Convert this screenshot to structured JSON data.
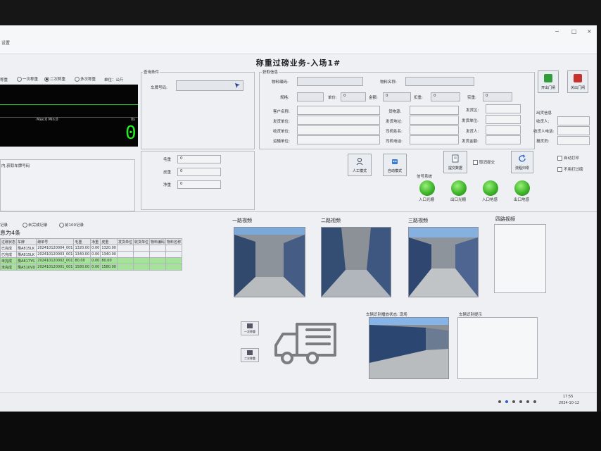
{
  "window": {
    "left_label": "设置",
    "controls": [
      "−",
      "□",
      "×"
    ]
  },
  "main_title": "称重过磅业务-入场1#",
  "weighing_mode": {
    "cut_label": "称重",
    "options": [
      "一次称重",
      "二次称重",
      "多次称重"
    ],
    "selected": 1,
    "unit_label": "单位：公斤"
  },
  "scale": {
    "max_label": "Max:0 Min:0",
    "corner": "0s",
    "reading": "0"
  },
  "plate_hint": "内,获取车牌号码",
  "query": {
    "title": "查询条件",
    "plate_label": "车牌号码:",
    "plate_value": ""
  },
  "info": {
    "title": "获取信息",
    "material_code_label": "物料编码:",
    "material_name_label": "物料名称:",
    "spec_label": "规格:",
    "unit_price_label": "单价:",
    "unit_price_value": "0",
    "amount_label": "金额:",
    "amount_value": "0",
    "deduct_label": "扣重:",
    "deduct_value": "0",
    "actual_label": "实重:",
    "actual_value": "0",
    "customer_label": "客户名称:",
    "shipper_unit_label": "发货单位:",
    "receiver_unit_label": "收货单位:",
    "transport_unit_label": "运输单位:",
    "origin_label": "货物源:",
    "ship_addr_label": "发货地址:",
    "driver_name_label": "司机姓名:",
    "driver_phone_label": "司机电话:",
    "shipping_area_label": "发货区:",
    "ship_unit2_label": "发货单位:",
    "shipper_person_label": "发货人:",
    "ship_amount_label": "发货金额:"
  },
  "gates": {
    "open_label": "开出门闸",
    "close_label": "关出门闸"
  },
  "out_info": {
    "title": "出货信息",
    "receiver_label": "收货人:",
    "receiver_phone_label": "收货人电话:",
    "report_label": "报货员:"
  },
  "weights": {
    "gross_label": "毛重",
    "gross_value": "0",
    "tare_label": "皮重",
    "tare_value": "0",
    "net_label": "净重",
    "net_value": "0"
  },
  "actions": {
    "manual": "人工模式",
    "auto": "自动模式",
    "submit": "提交数据",
    "cancel_submit": "取消提交",
    "reset": "流程归零",
    "auto_print": "自动打印",
    "no_print": "不用打过磅"
  },
  "signals": {
    "title": "信号系统",
    "items": [
      "入口光栅",
      "出口光栅",
      "入口地感",
      "出口地感"
    ],
    "color": "#3fb52a"
  },
  "records": {
    "options": [
      "记录",
      "未完成记录",
      "前100记录"
    ],
    "count_text": "息为4条",
    "headers": [
      "过磅状态",
      "车牌",
      "磅单号",
      "毛重",
      "净重",
      "皮重",
      "发货单位",
      "收货单位",
      "物料编码",
      "物料名称"
    ],
    "rows": [
      {
        "status": "已完成",
        "plate": "豫A815LK",
        "no": "202410120004_001",
        "gross": "1320.00",
        "net": "0.00",
        "tare": "1320.00",
        "green": false
      },
      {
        "status": "已完成",
        "plate": "豫A815LK",
        "no": "202410120003_001",
        "gross": "1340.00",
        "net": "0.00",
        "tare": "1340.00",
        "green": false
      },
      {
        "status": "未完成",
        "plate": "豫A817YS",
        "no": "202410120002_001",
        "gross": "80.00",
        "net": "0.00",
        "tare": "80.00",
        "green": true
      },
      {
        "status": "未完成",
        "plate": "豫A510VD",
        "no": "202410120001_001",
        "gross": "1580.00",
        "net": "0.00",
        "tare": "1580.00",
        "green": true
      }
    ]
  },
  "cameras": {
    "cam1": "一路视频",
    "cam2": "二路视频",
    "cam3": "三路视频",
    "cam4": "四路视频",
    "recog_label": "车辆识别播放状态: 现场",
    "recog2_label": "车辆识别提示"
  },
  "side_buttons": {
    "first": "一次称重",
    "second": "二次称重"
  },
  "taskbar": {
    "time": "17:55",
    "date": "2024-10-12"
  }
}
